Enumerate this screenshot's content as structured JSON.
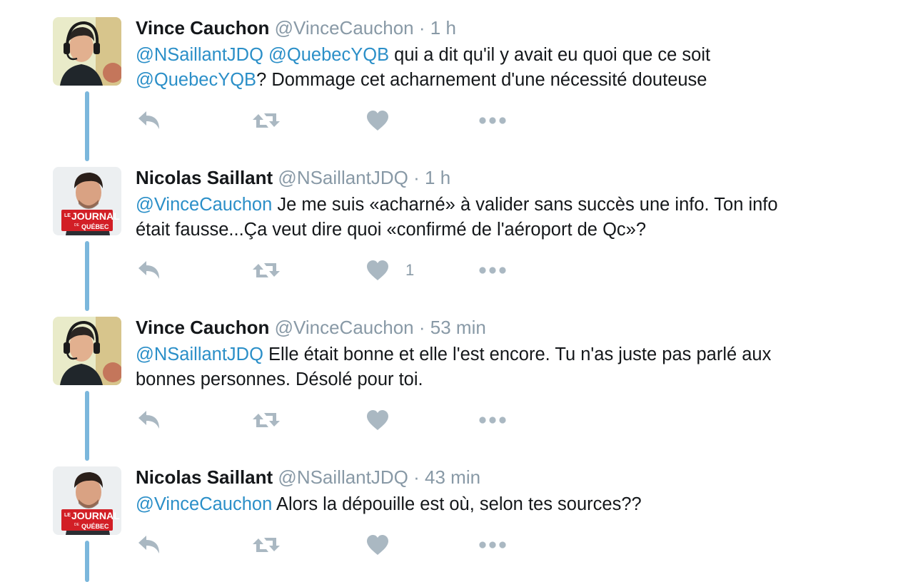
{
  "tweets": [
    {
      "name": "Vince Cauchon",
      "handle": "@VinceCauchon",
      "separator": "·",
      "time": "1 h",
      "avatar": "headset-man-avatar",
      "lines": [
        [
          {
            "text": "@NSaillantJDQ",
            "mention": true
          },
          {
            "text": " ",
            "mention": false
          },
          {
            "text": "@QuebecYQB",
            "mention": true
          },
          {
            "text": " qui a dit qu'il y avait eu quoi que ce soit",
            "mention": false
          }
        ],
        [
          {
            "text": "@QuebecYQB",
            "mention": true
          },
          {
            "text": "? Dommage cet acharnement d'une nécessité douteuse",
            "mention": false
          }
        ]
      ],
      "likes": ""
    },
    {
      "name": "Nicolas Saillant",
      "handle": "@NSaillantJDQ",
      "separator": "·",
      "time": "1 h",
      "avatar": "journal-quebec-avatar",
      "lines": [
        [
          {
            "text": "@VinceCauchon",
            "mention": true
          },
          {
            "text": " Je me suis «acharné» à valider sans succès une info. Ton info",
            "mention": false
          }
        ],
        [
          {
            "text": "était fausse...Ça veut dire quoi «confirmé de l'aéroport de Qc»?",
            "mention": false
          }
        ]
      ],
      "likes": "1"
    },
    {
      "name": "Vince Cauchon",
      "handle": "@VinceCauchon",
      "separator": "·",
      "time": "53 min",
      "avatar": "headset-man-avatar",
      "lines": [
        [
          {
            "text": "@NSaillantJDQ",
            "mention": true
          },
          {
            "text": " Elle était bonne et elle l'est encore. Tu n'as juste pas parlé aux",
            "mention": false
          }
        ],
        [
          {
            "text": "bonnes personnes. Désolé pour toi.",
            "mention": false
          }
        ]
      ],
      "likes": ""
    },
    {
      "name": "Nicolas Saillant",
      "handle": "@NSaillantJDQ",
      "separator": "·",
      "time": "43 min",
      "avatar": "journal-quebec-avatar",
      "lines": [
        [
          {
            "text": "@VinceCauchon",
            "mention": true
          },
          {
            "text": " Alors la dépouille est où, selon tes sources??",
            "mention": false
          }
        ]
      ],
      "likes": ""
    }
  ],
  "avatar_logo": {
    "top": "LE",
    "main": "JOURNAL",
    "small": "DE",
    "bottom": "QUÉBEC"
  },
  "actions": {
    "reply": "reply-icon",
    "retweet": "retweet-icon",
    "like": "heart-icon",
    "more": "more-icon"
  },
  "colors": {
    "mention": "#2b8fc8",
    "thread_line": "#7bb7dc",
    "meta": "#8899a6",
    "icon": "#aab8c2",
    "text": "#14171a",
    "logo_red": "#d21f26"
  }
}
